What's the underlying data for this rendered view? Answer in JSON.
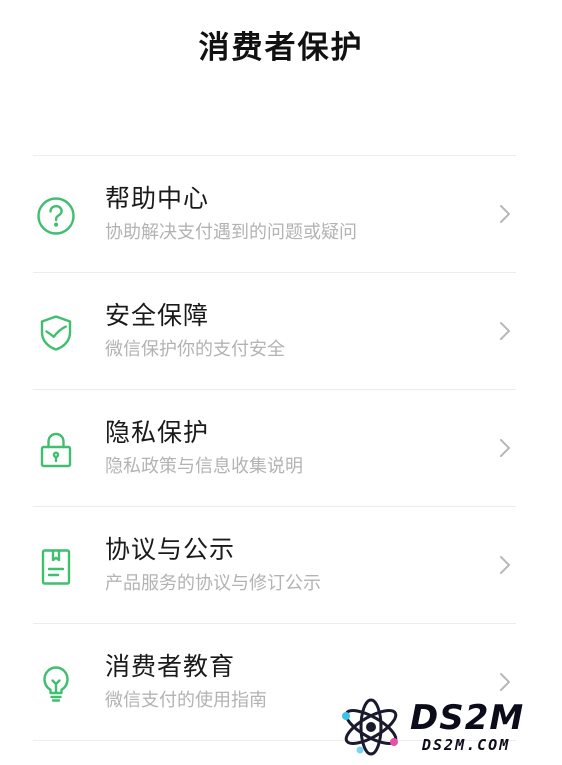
{
  "header": {
    "title": "消费者保护"
  },
  "colors": {
    "accent": "#3fbf6f",
    "chevron": "#b8b8b8",
    "subtitle": "#b3b3b3",
    "divider": "#ececec"
  },
  "menu": {
    "items": [
      {
        "icon": "help-question-icon",
        "title": "帮助中心",
        "subtitle": "协助解决支付遇到的问题或疑问"
      },
      {
        "icon": "security-shield-icon",
        "title": "安全保障",
        "subtitle": "微信保护你的支付安全"
      },
      {
        "icon": "privacy-lock-icon",
        "title": "隐私保护",
        "subtitle": "隐私政策与信息收集说明"
      },
      {
        "icon": "agreement-document-icon",
        "title": "协议与公示",
        "subtitle": "产品服务的协议与修订公示"
      },
      {
        "icon": "education-lightbulb-icon",
        "title": "消费者教育",
        "subtitle": "微信支付的使用指南"
      }
    ]
  },
  "watermark": {
    "brand": "DS2M",
    "domain": "DS2M.COM"
  }
}
